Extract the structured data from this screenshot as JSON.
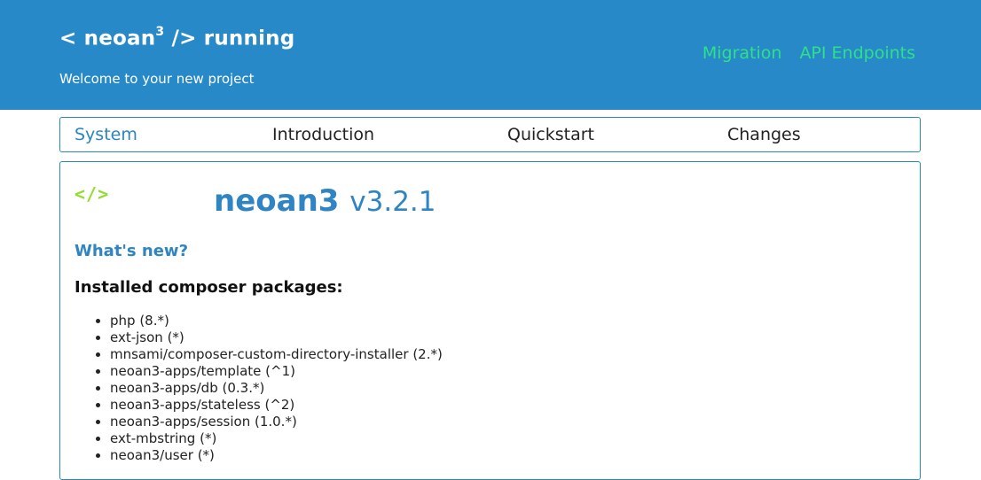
{
  "header": {
    "brand_prefix": "< neoan",
    "brand_sup": "3",
    "brand_suffix": " /> running",
    "subtitle": "Welcome to your new project",
    "nav": [
      {
        "label": "Migration"
      },
      {
        "label": "API Endpoints"
      }
    ]
  },
  "tabs": [
    {
      "label": "System",
      "active": true
    },
    {
      "label": "Introduction",
      "active": false
    },
    {
      "label": "Quickstart",
      "active": false
    },
    {
      "label": "Changes",
      "active": false
    }
  ],
  "panel": {
    "logo_mark": "</>",
    "product_name": "neoan3",
    "version": "v3.2.1",
    "whats_new": "What's new?",
    "packages_heading": "Installed composer packages:",
    "packages": [
      "php (8.*)",
      "ext-json (*)",
      "mnsami/composer-custom-directory-installer (2.*)",
      "neoan3-apps/template (^1)",
      "neoan3-apps/db (0.3.*)",
      "neoan3-apps/stateless (^2)",
      "neoan3-apps/session (1.0.*)",
      "ext-mbstring (*)",
      "neoan3/user (*)"
    ]
  },
  "colors": {
    "header_bg": "#2789c8",
    "nav_link": "#2ee08a",
    "accent_blue": "#2f84c3",
    "logo_green": "#94dc2c"
  }
}
